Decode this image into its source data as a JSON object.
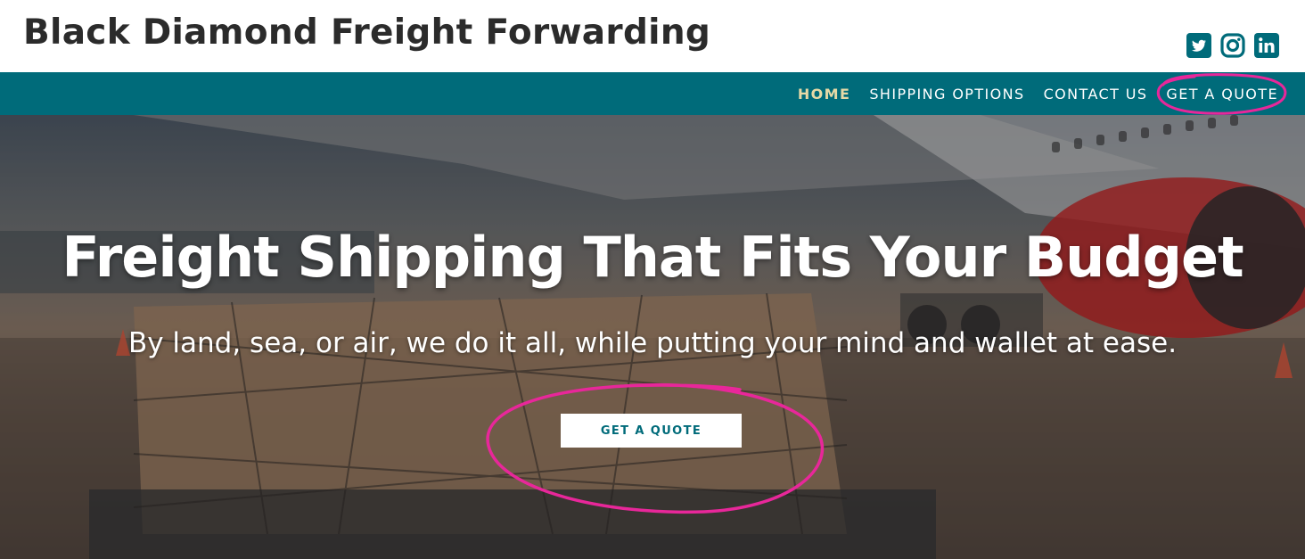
{
  "header": {
    "site_title": "Black Diamond Freight Forwarding",
    "social_icons": [
      "twitter-icon",
      "instagram-icon",
      "linkedin-icon"
    ]
  },
  "nav": {
    "items": [
      {
        "label": "HOME",
        "active": true
      },
      {
        "label": "SHIPPING OPTIONS",
        "active": false
      },
      {
        "label": "CONTACT US",
        "active": false
      },
      {
        "label": "GET A QUOTE",
        "active": false
      }
    ]
  },
  "hero": {
    "headline": "Freight Shipping That Fits Your Budget",
    "subheadline": "By land, sea, or air, we do it all, while putting your mind and wallet at ease.",
    "cta_label": "GET A QUOTE"
  },
  "colors": {
    "brand_teal": "#006b7a",
    "active_nav": "#e6d9a6",
    "annotation_pink": "#e8279a",
    "title_text": "#2b2b2b"
  }
}
